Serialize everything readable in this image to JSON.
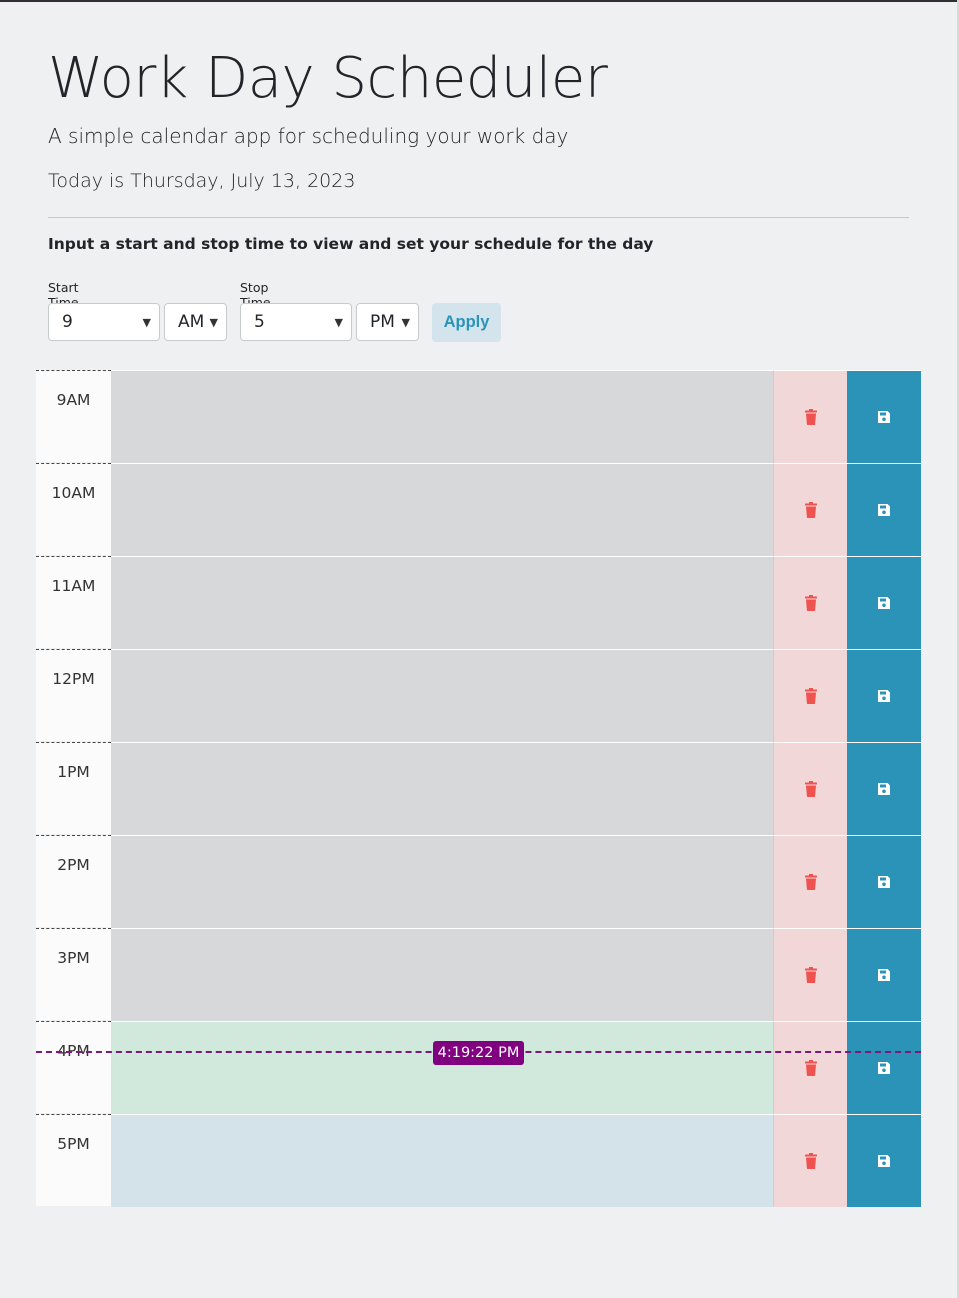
{
  "header": {
    "title": "Work Day Scheduler",
    "lead": "A simple calendar app for scheduling your work day",
    "today": "Today is Thursday, July 13, 2023"
  },
  "controls": {
    "instruction": "Input a start and stop time to view and set your schedule for the day",
    "start_label": "Start Time",
    "start_hour": "9",
    "start_ampm": "AM",
    "stop_label": "Stop Time",
    "stop_hour": "5",
    "stop_ampm": "PM",
    "apply_label": "Apply"
  },
  "current_time": "4:19:22 PM",
  "hours": [
    {
      "label": "9AM",
      "state": "past"
    },
    {
      "label": "10AM",
      "state": "past"
    },
    {
      "label": "11AM",
      "state": "past"
    },
    {
      "label": "12PM",
      "state": "past"
    },
    {
      "label": "1PM",
      "state": "past"
    },
    {
      "label": "2PM",
      "state": "past"
    },
    {
      "label": "3PM",
      "state": "past"
    },
    {
      "label": "4PM",
      "state": "present"
    },
    {
      "label": "5PM",
      "state": "future"
    }
  ],
  "colors": {
    "accent": "#2c93b8",
    "delete_icon": "#ef5350",
    "now_marker": "#800080"
  },
  "icons": {
    "delete": "trash-icon",
    "save": "floppy-disk-icon"
  }
}
